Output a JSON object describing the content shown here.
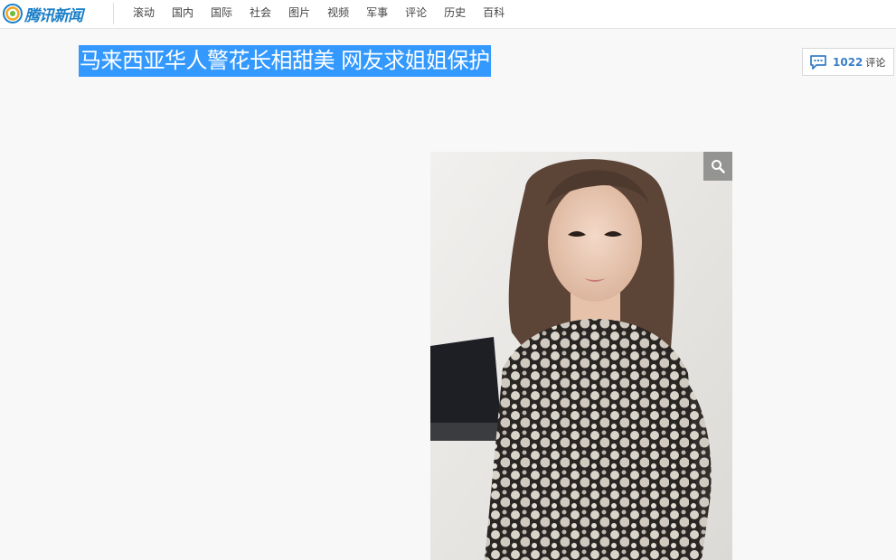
{
  "site": {
    "logo_text": "腾讯新闻"
  },
  "nav": {
    "items": [
      "滚动",
      "国内",
      "国际",
      "社会",
      "图片",
      "视频",
      "军事",
      "评论",
      "历史",
      "百科"
    ]
  },
  "article": {
    "headline": "马来西亚华人警花长相甜美 网友求姐姐保护"
  },
  "comments": {
    "count": "1022",
    "label": "评论"
  },
  "photo": {
    "zoom_icon": "magnifier-icon"
  },
  "colors": {
    "headline_selection": "#3399ff",
    "brand_blue": "#1a7fc9",
    "comment_count": "#3a7fc4"
  }
}
